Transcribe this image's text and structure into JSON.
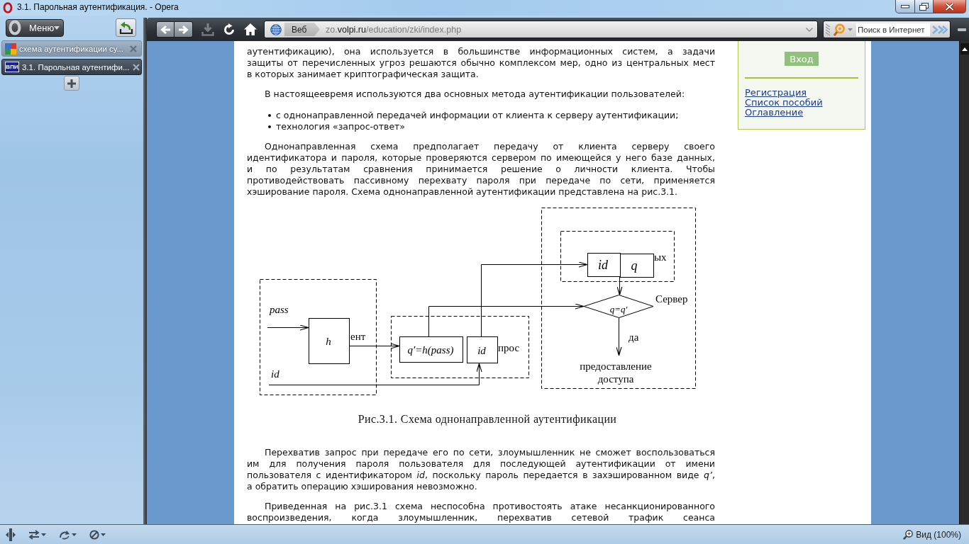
{
  "window": {
    "title": "3.1. Парольная аутентификация. - Opera"
  },
  "sidebar": {
    "menu_button": "Меню",
    "tabs": [
      {
        "title": "схема аутентификации су...",
        "favicon": {
          "kind": "tiles"
        },
        "selected": false
      },
      {
        "title": "3.1. Парольная аутентифи...",
        "favicon": {
          "kind": "badge",
          "text": "ВПИ"
        },
        "selected": true
      }
    ]
  },
  "toolbar": {
    "buttons": [
      {
        "kind": "back",
        "disabled": false
      },
      {
        "kind": "forward",
        "disabled": false
      },
      {
        "kind": "download",
        "disabled": true
      },
      {
        "kind": "reload",
        "disabled": false
      },
      {
        "kind": "home",
        "disabled": false
      }
    ],
    "address": {
      "scope": "Веб",
      "url": {
        "subdomain": "zo.",
        "domain": "volpi.ru",
        "path": "/education/zki/index.php"
      }
    },
    "search": {
      "placeholder": "Поиск в Интернет"
    }
  },
  "page": {
    "blocks": [
      {
        "kind": "paragraph",
        "starts_above": true,
        "continues_below": false,
        "lines": [
          "аутентификацию), она используется в большинстве информационных систем, а задачи",
          "защиты от перечисленных угроз решаются обычно комплексом мер, одно из центральных мест",
          "в которых занимает криптографическая защита."
        ]
      },
      {
        "kind": "paragraph",
        "starts_above": false,
        "continues_below": false,
        "lines": [
          "В настоящеевремя используются два основных метода аутентификации пользователей:"
        ]
      },
      {
        "kind": "list",
        "items": [
          "с однонаправленной передачей информации от клиента к серверу аутентификации;",
          "технология «запрос-ответ»"
        ]
      },
      {
        "kind": "paragraph",
        "starts_above": false,
        "continues_below": false,
        "lines": [
          "Однонаправленная схема предполагает передачу от клиента серверу своего",
          "идентификатора и пароля, которые проверяются сервером по имеющейся у него базе данных,",
          "и по результатам сравнения принимается решение о личности клиента. Чтобы",
          "противодействовать пассивному перехвату пароля при передаче по сети, применяется",
          "хэширование пароля. Схема однонаправленной аутентификации представлена на рис.3.1."
        ]
      },
      {
        "kind": "figure",
        "diagram": {
          "client": {
            "input": "pass",
            "function": "h",
            "label": "ент",
            "id": "id"
          },
          "request": {
            "hash": "q′=h(pass)",
            "id": "id",
            "label": "прос"
          },
          "database": {
            "id": "id",
            "hash": "q",
            "label": "ых"
          },
          "server": {
            "label": "Сервер",
            "check": "q=q′",
            "yes": "да",
            "result": "предоставление доступа"
          }
        },
        "caption": "Рис.3.1. Схема однонаправленной аутентификации"
      },
      {
        "kind": "paragraph",
        "starts_above": false,
        "continues_below": false,
        "lines": [
          "Перехватив запрос при передаче его по сети, злоумышленник не сможет воспользоваться",
          "им для получения пароля пользователя для последующей аутентификации от имени",
          "пользователя с идентификатором *id*, поскольку пароль передается в захэшированном виде *q’*,",
          "а обратить операцию хэширования невозможно."
        ]
      },
      {
        "kind": "paragraph",
        "starts_above": false,
        "continues_below": true,
        "lines": [
          "Приведенная на рис.3.1 схема неспособна противостоять атаке несанкционированного",
          "воспроизведения, когда злоумышленник, перехватив сетевой трафик сеанса"
        ]
      }
    ],
    "aside": {
      "login_button": "Вход",
      "links": [
        "Регистрация",
        "Список пособий",
        "Оглавление"
      ]
    }
  },
  "status_bar": {
    "zoom": "Вид (100%)"
  }
}
